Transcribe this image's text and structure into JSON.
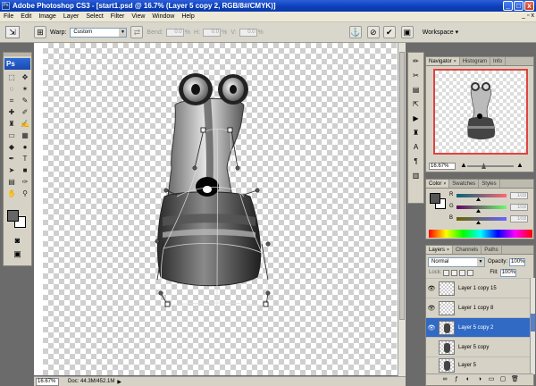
{
  "app": {
    "title": "Adobe Photoshop CS3 - [start1.psd @ 16.7% (Layer 5 copy 2, RGB/8#/CMYK)]",
    "icon_label": "Ps"
  },
  "window_buttons": {
    "minimize": "_",
    "maximize": "□",
    "close": "x"
  },
  "menu": [
    "File",
    "Edit",
    "Image",
    "Layer",
    "Select",
    "Filter",
    "View",
    "Window",
    "Help"
  ],
  "doc_controls": {
    "minimize": "_",
    "restore": "▫",
    "close": "x"
  },
  "options": {
    "warp_label": "Warp:",
    "warp_value": "Custom",
    "bend_label": "Bend:",
    "bend_value": "0.0",
    "bend_unit": "%",
    "h_label": "H:",
    "h_value": "0.0",
    "h_unit": "%",
    "v_label": "V:",
    "v_value": "0.0",
    "v_unit": "%",
    "workspace_label": "Workspace ▾"
  },
  "toolbox": {
    "logo": "Ps"
  },
  "navigator": {
    "tabs": [
      {
        "label": "Navigator",
        "active": true
      },
      {
        "label": "Histogram",
        "active": false
      },
      {
        "label": "Info",
        "active": false
      }
    ],
    "zoom": "16.67%"
  },
  "color": {
    "tabs": [
      {
        "label": "Color",
        "active": true
      },
      {
        "label": "Swatches",
        "active": false
      },
      {
        "label": "Styles",
        "active": false
      }
    ],
    "r_label": "R",
    "r_value": "103",
    "g_label": "G",
    "g_value": "103",
    "b_label": "B",
    "b_value": "103"
  },
  "layers": {
    "tabs": [
      {
        "label": "Layers",
        "active": true
      },
      {
        "label": "Channels",
        "active": false
      },
      {
        "label": "Paths",
        "active": false
      }
    ],
    "blend_mode": "Normal",
    "opacity_label": "Opacity:",
    "opacity_value": "100%",
    "lock_label": "Lock:",
    "fill_label": "Fill:",
    "fill_value": "100%",
    "items": [
      {
        "name": "Layer 1 copy 15",
        "visible": true,
        "selected": false
      },
      {
        "name": "Layer 1 copy 8",
        "visible": true,
        "selected": false
      },
      {
        "name": "Layer 5 copy 2",
        "visible": true,
        "selected": true
      },
      {
        "name": "Layer 5 copy",
        "visible": false,
        "selected": false
      },
      {
        "name": "Layer 5",
        "visible": false,
        "selected": false
      }
    ]
  },
  "status": {
    "zoom": "16.67%",
    "doc_info": "Doc: 44.3M/452.1M"
  }
}
